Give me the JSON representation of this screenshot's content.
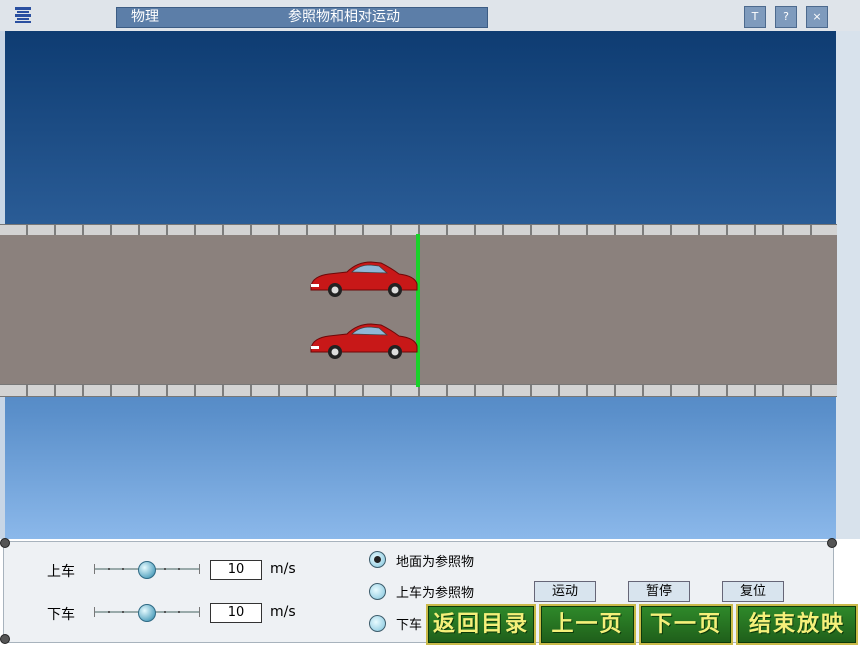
{
  "window": {
    "subject": "物理",
    "lesson_title": "参照物和相对运动",
    "buttons": [
      "T",
      "?",
      "×"
    ]
  },
  "scene": {
    "cars": [
      {
        "name": "upper-car",
        "color": "#c81818"
      },
      {
        "name": "lower-car",
        "color": "#c81818"
      }
    ],
    "marker_color": "#19d22a"
  },
  "controls": {
    "upper": {
      "label": "上车",
      "speed": "10",
      "unit": "m/s"
    },
    "lower": {
      "label": "下车",
      "speed": "10",
      "unit": "m/s"
    }
  },
  "reference": {
    "options": [
      "地面为参照物",
      "上车为参照物",
      "下车"
    ],
    "selected": 0
  },
  "actions": {
    "move": "运动",
    "pause": "暂停",
    "reset": "复位"
  },
  "navigation": {
    "back_to_contents": "返回目录",
    "previous_page": "上一页",
    "next_page": "下一页",
    "end_show": "结束放映"
  }
}
